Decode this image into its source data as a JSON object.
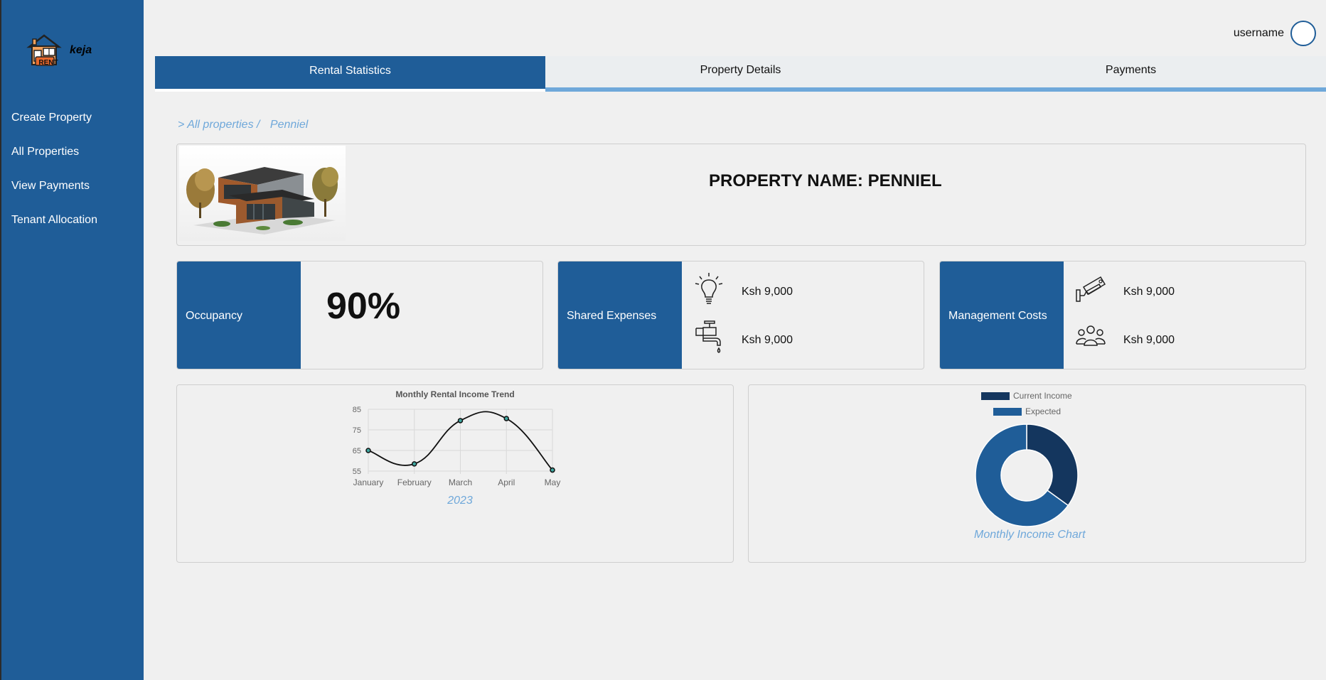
{
  "brand": {
    "name": "keja",
    "logo_badge": "RENT"
  },
  "sidebar": {
    "items": [
      {
        "label": "Create Property"
      },
      {
        "label": "All Properties"
      },
      {
        "label": "View Payments"
      },
      {
        "label": "Tenant Allocation"
      }
    ]
  },
  "header": {
    "username": "username"
  },
  "tabs": [
    {
      "label": "Rental Statistics",
      "active": true
    },
    {
      "label": "Property Details",
      "active": false
    },
    {
      "label": "Payments",
      "active": false
    }
  ],
  "breadcrumb": {
    "root": "> All properties /",
    "current": "Penniel"
  },
  "property": {
    "title": "PROPERTY NAME: PENNIEL"
  },
  "stats": {
    "occupancy": {
      "label": "Occupancy",
      "value": "90%"
    },
    "shared": {
      "label": "Shared Expenses",
      "electricity": "Ksh 9,000",
      "water": "Ksh 9,000",
      "icons": [
        "lightbulb-icon",
        "water-tap-icon"
      ]
    },
    "management": {
      "label": "Management Costs",
      "security": "Ksh 9,000",
      "staff": "Ksh 9,000",
      "icons": [
        "security-camera-icon",
        "staff-group-icon"
      ]
    }
  },
  "colors": {
    "primary": "#1f5d98",
    "accent": "#6fa8da",
    "dark": "#14365e",
    "background": "#f0f0f0"
  },
  "chart_data": [
    {
      "type": "line",
      "title": "Monthly Rental Income Trend",
      "categories": [
        "January",
        "February",
        "March",
        "April",
        "May"
      ],
      "series": [
        {
          "values": [
            65,
            58.5,
            79.5,
            80.5,
            55.5
          ]
        }
      ],
      "yticks": [
        "85",
        "75",
        "65",
        "55"
      ],
      "ylim": [
        55,
        85
      ],
      "caption": "2023",
      "grid": true,
      "smooth": true
    },
    {
      "type": "pie",
      "subtype": "doughnut",
      "labels": [
        "Current Income",
        "Expected"
      ],
      "values": [
        35,
        65
      ],
      "colors": [
        "#14365e",
        "#1f5d98"
      ],
      "legend": "top",
      "caption": "Monthly Income Chart"
    }
  ]
}
